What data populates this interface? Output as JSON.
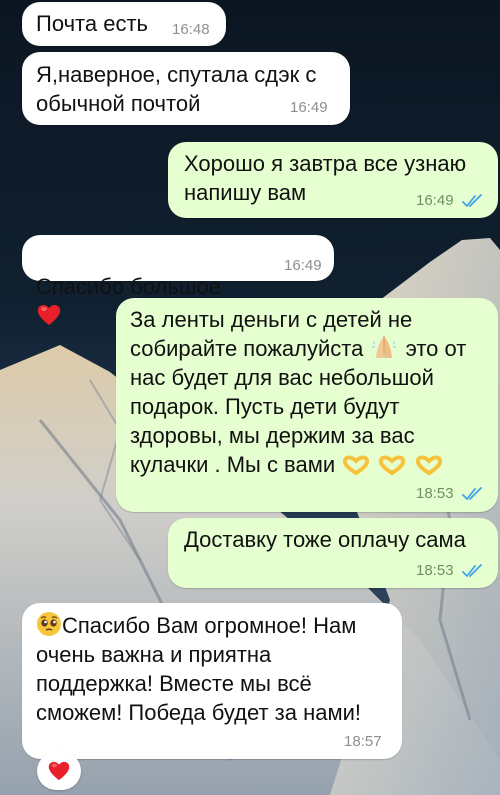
{
  "chat": {
    "messages": [
      {
        "id": "m1",
        "direction": "incoming",
        "text": "Почта есть",
        "time": "16:48"
      },
      {
        "id": "m2",
        "direction": "incoming",
        "text": "Я,наверное, спутала сдэк с\nобычной почтой",
        "time": "16:49"
      },
      {
        "id": "m3",
        "direction": "outgoing",
        "text": "Хорошо я завтра все узнаю\nнапишу вам",
        "time": "16:49",
        "status": "read"
      },
      {
        "id": "m4",
        "direction": "incoming",
        "text": "Спасибо большое",
        "time": "16:49",
        "emoji": "red-heart"
      },
      {
        "id": "m5",
        "direction": "outgoing",
        "lines": [
          "За ленты деньги с детей не",
          "собирайте пожалуйста",
          "это от",
          "нас будет для вас небольшой",
          "подарок. Пусть дети будут",
          "здоровы, мы держим за вас",
          "кулачки . Мы с вами"
        ],
        "time": "18:53",
        "status": "read",
        "emojis": [
          "folded-hands",
          "heart-hands",
          "heart-hands",
          "heart-hands"
        ]
      },
      {
        "id": "m6",
        "direction": "outgoing",
        "text": "Доставку тоже оплачу сама",
        "time": "18:53",
        "status": "read"
      },
      {
        "id": "m7",
        "direction": "incoming",
        "lines": [
          "Спасибо Вам огромное! Нам",
          "очень важна и приятна",
          "поддержка! Вместе мы всё",
          "сможем! Победа будет за нами!"
        ],
        "time": "18:57",
        "emoji": "pleading-face",
        "reaction": "red-heart"
      }
    ]
  },
  "colors": {
    "incoming_bubble": "#ffffff",
    "outgoing_bubble": "#e6ffd1",
    "read_check": "#3fa3e8",
    "time_text": "#8e8e93"
  }
}
